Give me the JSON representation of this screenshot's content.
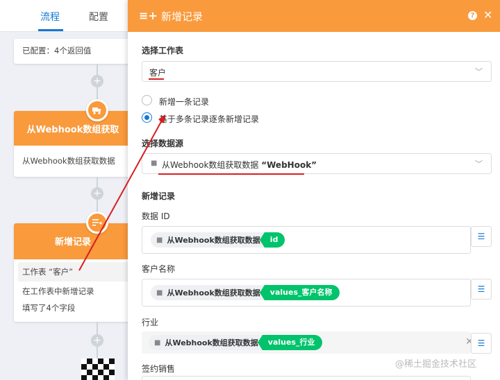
{
  "tabs": {
    "flow": "流程",
    "config": "配置"
  },
  "node_top": {
    "text": "已配置：4个返回值"
  },
  "node_webhook": {
    "title": "从Webhook数组获取",
    "desc": "从Webhook数组获取数据",
    "icon": "truck-icon"
  },
  "node_add": {
    "title": "新增记录",
    "line1": "工作表 “客户”",
    "line2": "在工作表中新增记录",
    "line3": "填写了4个字段"
  },
  "panel": {
    "title": "新增记录",
    "help": "?",
    "close": "✕",
    "select_sheet_label": "选择工作表",
    "sheet_value": "客户",
    "radio_single": "新增一条记录",
    "radio_multi": "基于多条记录逐条新增记录",
    "select_source_label": "选择数据源",
    "source_value": "从Webhook数组获取数据",
    "source_bold": "“WebHook”",
    "section_label": "新增记录",
    "fields": [
      {
        "label": "数据 ID",
        "chip": "从Webhook数组获取数据",
        "tag": "id"
      },
      {
        "label": "客户名称",
        "chip": "从Webhook数组获取数据",
        "tag": "values_客户名称"
      },
      {
        "label": "行业",
        "chip": "从Webhook数组获取数据",
        "tag": "values_行业"
      },
      {
        "label": "签约销售"
      }
    ]
  },
  "watermark": "@稀土掘金技术社区",
  "colors": {
    "accent": "#f99a3c",
    "primary": "#1677d2",
    "tag": "#00c36b",
    "annotation": "#d81e1e"
  }
}
